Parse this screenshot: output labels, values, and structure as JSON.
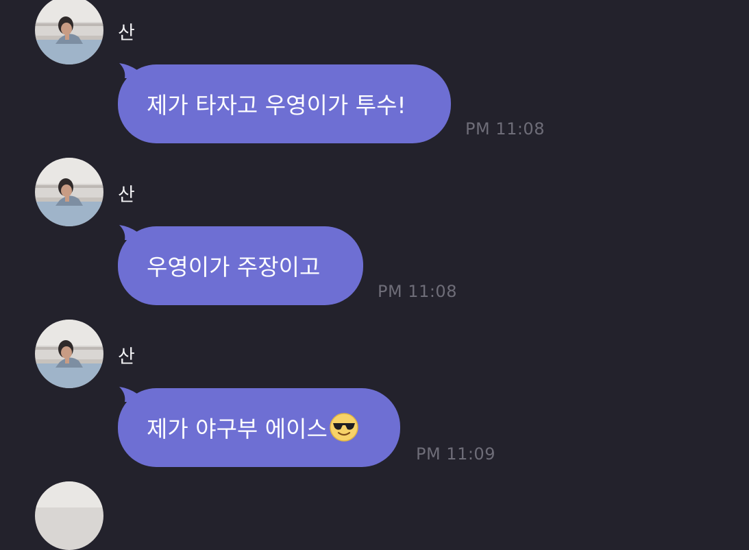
{
  "chat": {
    "messages": [
      {
        "sender": "산",
        "text": "제가 타자고 우영이가 투수!",
        "time": "PM 11:08",
        "emoji": ""
      },
      {
        "sender": "산",
        "text": "우영이가 주장이고",
        "time": "PM 11:08",
        "emoji": ""
      },
      {
        "sender": "산",
        "text": "제가 야구부 에이스",
        "time": "PM 11:09",
        "emoji": "smiling-face-with-sunglasses"
      }
    ]
  },
  "colors": {
    "background": "#23222c",
    "bubble": "#6e6fd3",
    "timestamp": "#6e6d78",
    "name": "#f2f2f4"
  }
}
